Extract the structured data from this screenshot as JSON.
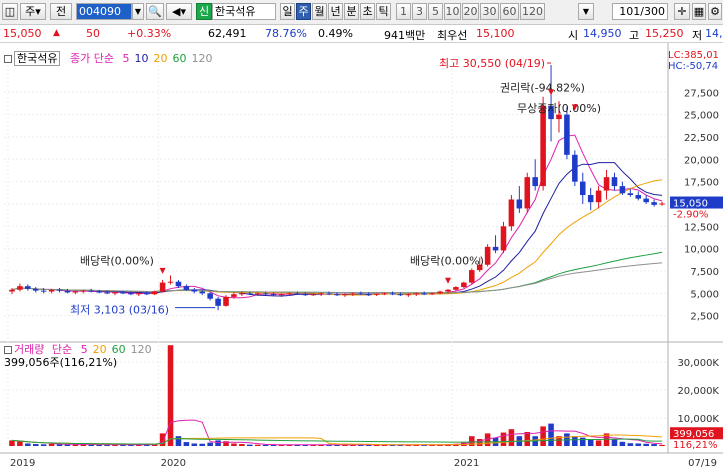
{
  "toolbar": {
    "market_btn": "주",
    "prev_label": "전",
    "stock_code": "004090",
    "shin_badge": "신",
    "stock_name": "한국석유",
    "periods": [
      "일",
      "주",
      "월",
      "년",
      "분",
      "초",
      "틱"
    ],
    "active_period": "주",
    "numbers": [
      "1",
      "3",
      "5",
      "10",
      "20",
      "30",
      "60",
      "120"
    ],
    "page_counter": "101/300"
  },
  "infobar": {
    "price": "15,050",
    "change": "50",
    "change_pct": "+0.33%",
    "volume": "62,491",
    "vol_ratio": "78.76%",
    "turnover": "0.49%",
    "amount": "941백만",
    "best_sell_label": "최우선",
    "best_sell": "15,100",
    "best_buy": "15,050",
    "open_label": "시",
    "open": "14,950",
    "high_label": "고",
    "high": "15,250",
    "low_label": "저",
    "low": "14,"
  },
  "legend": {
    "stock_name": "한국석유",
    "price_label": "종가 단순",
    "ma_periods": [
      "5",
      "10",
      "20",
      "60",
      "120"
    ],
    "volume_label": "거래량",
    "vol_ma_label": "단순",
    "vol_ma_periods": [
      "5",
      "20",
      "60",
      "120"
    ],
    "volume_value": "399,056주(116,21%)",
    "lc_label": "LC:385,01",
    "hc_label": "HC:-50,74"
  },
  "annotations": {
    "high": "최고 30,550 (04/19)",
    "low": "최저 3,103 (03/16)",
    "dividend1": "배당락(0.00%)",
    "dividend2": "배당락(0.00%)",
    "rights": "권리락(-94.82%)",
    "bonus": "무상증자(0.00%)"
  },
  "price_axis": {
    "ticks": [
      2500,
      5000,
      7500,
      10000,
      12500,
      15000,
      17500,
      20000,
      22500,
      25000,
      27500
    ],
    "current_label": "15,050",
    "current_pct": "-2.90%"
  },
  "volume_axis": {
    "ticks": [
      "30,000K",
      "20,000K",
      "10,000K"
    ],
    "current_label": "399,056",
    "current_pct": "116,21%"
  },
  "x_axis": {
    "labels": [
      "2019",
      "2020",
      "2021"
    ],
    "right_label": "07/19"
  },
  "colors": {
    "up": "#e0141e",
    "down": "#1e3cc8",
    "ma5": "#e020b0",
    "ma10": "#1e1ea0",
    "ma20": "#f0a000",
    "ma60": "#20a040",
    "ma120": "#909090"
  },
  "chart_data": {
    "type": "candlestick",
    "title": "한국석유",
    "ylim": [
      0,
      31000
    ],
    "vol_ylim": [
      0,
      35000
    ],
    "x_labels": [
      "2019",
      "2020",
      "2021"
    ],
    "candles": [
      [
        5200,
        5600,
        4900,
        5400,
        2000
      ],
      [
        5400,
        6100,
        5200,
        5800,
        1600
      ],
      [
        5800,
        6000,
        5300,
        5500,
        900
      ],
      [
        5500,
        5700,
        5100,
        5300,
        700
      ],
      [
        5300,
        5600,
        5000,
        5200,
        600
      ],
      [
        5200,
        5500,
        5000,
        5400,
        800
      ],
      [
        5400,
        5600,
        5100,
        5300,
        600
      ],
      [
        5300,
        5500,
        5000,
        5100,
        500
      ],
      [
        5100,
        5300,
        4900,
        5200,
        500
      ],
      [
        5200,
        5400,
        5000,
        5300,
        600
      ],
      [
        5300,
        5500,
        5100,
        5200,
        500
      ],
      [
        5200,
        5400,
        5000,
        5100,
        500
      ],
      [
        5100,
        5300,
        4900,
        5000,
        450
      ],
      [
        5000,
        5200,
        4800,
        5100,
        450
      ],
      [
        5100,
        5300,
        4900,
        5000,
        450
      ],
      [
        5000,
        5200,
        4800,
        4900,
        450
      ],
      [
        4900,
        5100,
        4700,
        5000,
        450
      ],
      [
        5000,
        5200,
        4800,
        4900,
        450
      ],
      [
        4900,
        5300,
        4800,
        5200,
        600
      ],
      [
        5200,
        6500,
        5100,
        6200,
        4500
      ],
      [
        6200,
        7000,
        6000,
        6300,
        36000
      ],
      [
        6300,
        6500,
        5600,
        5800,
        3500
      ],
      [
        5800,
        6000,
        5300,
        5400,
        1400
      ],
      [
        5400,
        5600,
        5000,
        5200,
        900
      ],
      [
        5200,
        5400,
        4800,
        5000,
        800
      ],
      [
        5000,
        5100,
        4200,
        4400,
        1200
      ],
      [
        4400,
        4600,
        3100,
        3600,
        2000
      ],
      [
        3600,
        4800,
        3500,
        4600,
        1700
      ],
      [
        4600,
        5100,
        4400,
        4900,
        900
      ],
      [
        4900,
        5200,
        4700,
        5000,
        700
      ],
      [
        5000,
        5200,
        4800,
        4900,
        500
      ],
      [
        4900,
        5100,
        4700,
        5000,
        450
      ],
      [
        5000,
        5200,
        4800,
        4900,
        450
      ],
      [
        4900,
        5100,
        4700,
        4800,
        450
      ],
      [
        4800,
        5000,
        4600,
        4900,
        450
      ],
      [
        4900,
        5100,
        4700,
        5000,
        450
      ],
      [
        5000,
        5200,
        4800,
        4900,
        450
      ],
      [
        4900,
        5100,
        4700,
        4850,
        450
      ],
      [
        4850,
        5000,
        4700,
        4900,
        450
      ],
      [
        4900,
        5100,
        4700,
        5000,
        450
      ],
      [
        5000,
        5200,
        4800,
        4900,
        450
      ],
      [
        4900,
        5100,
        4700,
        4800,
        450
      ],
      [
        4800,
        5000,
        4600,
        4900,
        450
      ],
      [
        4900,
        5100,
        4700,
        5000,
        450
      ],
      [
        5000,
        5200,
        4800,
        4900,
        450
      ],
      [
        4900,
        5100,
        4700,
        4850,
        450
      ],
      [
        4850,
        5000,
        4700,
        4950,
        450
      ],
      [
        4950,
        5100,
        4800,
        5000,
        450
      ],
      [
        5000,
        5200,
        4800,
        4900,
        450
      ],
      [
        4900,
        5100,
        4700,
        4800,
        450
      ],
      [
        4800,
        5000,
        4600,
        4900,
        450
      ],
      [
        4900,
        5100,
        4700,
        5000,
        450
      ],
      [
        5000,
        5200,
        4800,
        4950,
        450
      ],
      [
        4950,
        5100,
        4800,
        5000,
        450
      ],
      [
        5000,
        5300,
        4900,
        5200,
        500
      ],
      [
        5200,
        5500,
        5000,
        5400,
        600
      ],
      [
        5400,
        5800,
        5200,
        5700,
        800
      ],
      [
        5700,
        6300,
        5600,
        6200,
        1200
      ],
      [
        6200,
        7800,
        6000,
        7600,
        3500
      ],
      [
        7600,
        9000,
        7400,
        8200,
        2500
      ],
      [
        8200,
        10500,
        8000,
        10200,
        4500
      ],
      [
        10200,
        11500,
        9500,
        9800,
        3000
      ],
      [
        9800,
        13000,
        9500,
        12500,
        4800
      ],
      [
        12500,
        16000,
        12000,
        15500,
        6000
      ],
      [
        15500,
        17000,
        14000,
        14500,
        3500
      ],
      [
        14500,
        18500,
        14000,
        18000,
        5000
      ],
      [
        18000,
        20000,
        16500,
        17000,
        3500
      ],
      [
        17000,
        27000,
        16500,
        26000,
        7000
      ],
      [
        26000,
        30550,
        22000,
        24500,
        8000
      ],
      [
        24500,
        26500,
        23000,
        25000,
        3500
      ],
      [
        25000,
        25800,
        20000,
        20500,
        4500
      ],
      [
        20500,
        21000,
        17000,
        17500,
        3500
      ],
      [
        17500,
        18500,
        15000,
        16000,
        3000
      ],
      [
        16000,
        16800,
        14300,
        15200,
        2500
      ],
      [
        15200,
        17000,
        14500,
        16500,
        2000
      ],
      [
        16500,
        18800,
        15500,
        18000,
        4500
      ],
      [
        18000,
        18500,
        16500,
        17000,
        2500
      ],
      [
        17000,
        17500,
        16000,
        16200,
        1500
      ],
      [
        16200,
        16700,
        15800,
        16000,
        1000
      ],
      [
        16000,
        16400,
        15400,
        15600,
        900
      ],
      [
        15600,
        16000,
        15000,
        15200,
        800
      ],
      [
        15200,
        15500,
        14700,
        14900,
        700
      ],
      [
        14950,
        15250,
        14800,
        15050,
        400
      ]
    ]
  }
}
